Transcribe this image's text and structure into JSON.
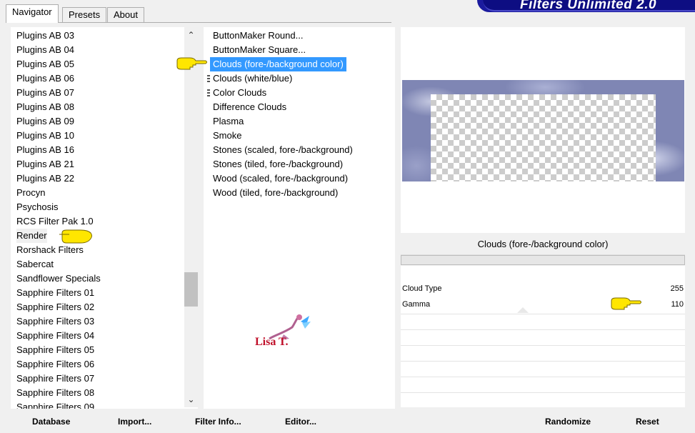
{
  "banner": {
    "title": "Filters Unlimited 2.0"
  },
  "tabs": [
    {
      "label": "Navigator",
      "active": true
    },
    {
      "label": "Presets",
      "active": false
    },
    {
      "label": "About",
      "active": false
    }
  ],
  "categories": [
    "Plugins AB 03",
    "Plugins AB 04",
    "Plugins AB 05",
    "Plugins AB 06",
    "Plugins AB 07",
    "Plugins AB 08",
    "Plugins AB 09",
    "Plugins AB 10",
    "Plugins AB 16",
    "Plugins AB 21",
    "Plugins AB 22",
    "Procyn",
    "Psychosis",
    "RCS Filter Pak 1.0",
    "Render",
    "Rorshack Filters",
    "Sabercat",
    "Sandflower Specials",
    "Sapphire Filters 01",
    "Sapphire Filters 02",
    "Sapphire Filters 03",
    "Sapphire Filters 04",
    "Sapphire Filters 05",
    "Sapphire Filters 06",
    "Sapphire Filters 07",
    "Sapphire Filters 08",
    "Sapphire Filters 09"
  ],
  "selected_category": "Render",
  "filters": [
    "ButtonMaker Round...",
    "ButtonMaker Square...",
    "Clouds (fore-/background color)",
    "Clouds (white/blue)",
    "Color Clouds",
    "Difference Clouds",
    "Plasma",
    "Smoke",
    "Stones (scaled, fore-/background)",
    "Stones (tiled, fore-/background)",
    "Wood (scaled, fore-/background)",
    "Wood (tiled, fore-/background)"
  ],
  "selected_filter": "Clouds (fore-/background color)",
  "filter_title": "Clouds (fore-/background color)",
  "controls": [
    {
      "label": "Cloud Type",
      "value": "255"
    },
    {
      "label": "Gamma",
      "value": "110"
    }
  ],
  "watermark": "Lisa T.",
  "buttons": {
    "database": "Database",
    "import": "Import...",
    "filter_info": "Filter Info...",
    "editor": "Editor...",
    "randomize": "Randomize",
    "reset": "Reset"
  },
  "colors": {
    "selection": "#3399ff",
    "banner": "#0d0d82",
    "pointer": "#ffe600"
  }
}
